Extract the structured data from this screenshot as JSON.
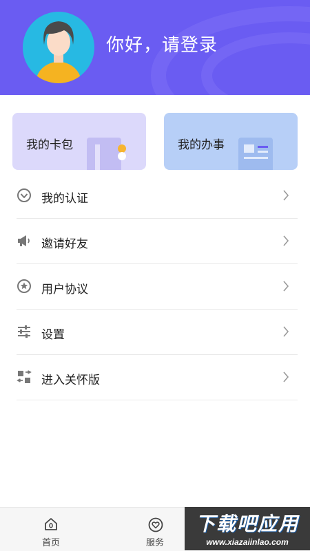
{
  "header": {
    "greeting": "你好，请登录",
    "background_color": "#6a5cf2",
    "avatar_color": "#27b9e3"
  },
  "cards": [
    {
      "label": "我的卡包",
      "icon": "wallet-card-icon",
      "color": "#dcd9fb"
    },
    {
      "label": "我的办事",
      "icon": "document-form-icon",
      "color": "#b7cff7"
    }
  ],
  "menu": {
    "items": [
      {
        "label": "我的认证",
        "icon": "verified-badge-icon"
      },
      {
        "label": "邀请好友",
        "icon": "megaphone-icon"
      },
      {
        "label": "用户协议",
        "icon": "star-circle-icon"
      },
      {
        "label": "设置",
        "icon": "sliders-icon"
      },
      {
        "label": "进入关怀版",
        "icon": "care-mode-icon"
      }
    ]
  },
  "tabbar": {
    "tabs": [
      {
        "label": "首页",
        "icon": "home-icon"
      },
      {
        "label": "服务",
        "icon": "heart-service-icon"
      }
    ]
  },
  "watermark": {
    "title": "下载吧应用",
    "url": "www.xiazaiinlao.com"
  }
}
